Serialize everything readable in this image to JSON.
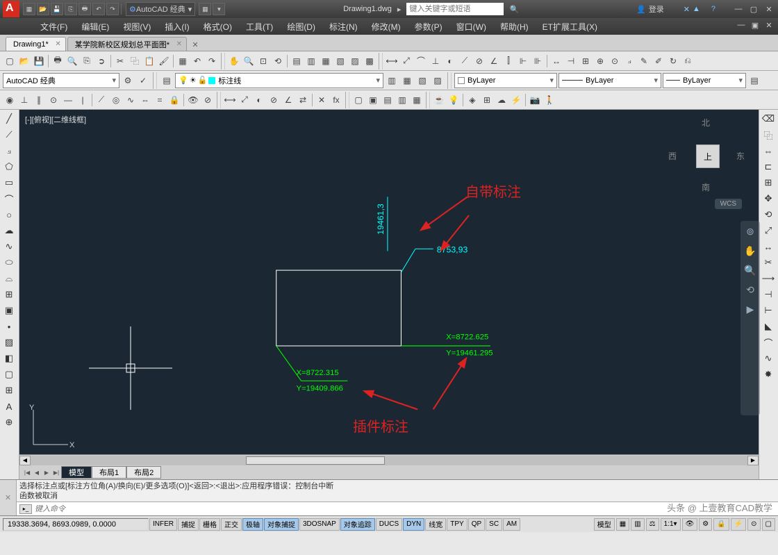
{
  "title": {
    "workspace": "AutoCAD 经典",
    "document": "Drawing1.dwg",
    "search_placeholder": "键入关键字或短语",
    "login": "登录"
  },
  "menu": [
    "文件(F)",
    "编辑(E)",
    "视图(V)",
    "插入(I)",
    "格式(O)",
    "工具(T)",
    "绘图(D)",
    "标注(N)",
    "修改(M)",
    "参数(P)",
    "窗口(W)",
    "帮助(H)",
    "ET扩展工具(X)"
  ],
  "tabs": {
    "active": "Drawing1*",
    "inactive": "某学院新校区规划总平面图*"
  },
  "props": {
    "workspace": "AutoCAD 经典",
    "layer": "标注线",
    "color": "ByLayer",
    "linetype": "ByLayer",
    "lineweight": "ByLayer"
  },
  "viewport": {
    "label": "[-][俯视][二维线框]",
    "cube": {
      "n": "北",
      "s": "南",
      "e": "东",
      "w": "西",
      "top": "上"
    },
    "wcs": "WCS"
  },
  "drawing": {
    "coord1_y": "19461,3",
    "coord1_x": "8753,93",
    "coord2": {
      "x": "X=8722.625",
      "y": "Y=19461.295"
    },
    "coord3": {
      "x": "X=8722.315",
      "y": "Y=19409.866"
    },
    "ann1": "自带标注",
    "ann2": "插件标注"
  },
  "layout_tabs": [
    "模型",
    "布局1",
    "布局2"
  ],
  "cmd": {
    "line1": "选择标注点或[标注方位角(A)/换向(E)/更多选项(O)]<返回>:<退出>:应用程序错误：控制台中断",
    "line2": "函数被取消",
    "placeholder": "键入命令"
  },
  "watermark": "头条 @ 上壹教育CAD教学",
  "status": {
    "coords": "19338.3694, 8693.0989, 0.0000",
    "buttons": [
      "INFER",
      "捕捉",
      "栅格",
      "正交",
      "极轴",
      "对象捕捉",
      "3DOSNAP",
      "对象追踪",
      "DUCS",
      "DYN",
      "线宽",
      "TPY",
      "QP",
      "SC",
      "AM"
    ],
    "active": [
      "极轴",
      "对象捕捉",
      "对象追踪",
      "DYN"
    ],
    "model": "模型",
    "scale": "1:1"
  }
}
